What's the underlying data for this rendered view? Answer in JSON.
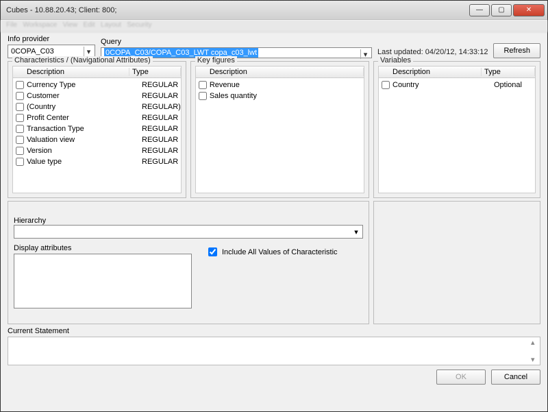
{
  "window": {
    "title": "Cubes - 10.88.20.43; Client: 800;"
  },
  "labels": {
    "info_provider": "Info provider",
    "query": "Query",
    "last_updated": "Last updated: 04/20/12, 14:33:12",
    "refresh": "Refresh",
    "characteristics": "Characteristics / (Navigational Attributes)",
    "key_figures": "Key figures",
    "variables": "Variables",
    "description": "Description",
    "type": "Type",
    "hierarchy": "Hierarchy",
    "display_attributes": "Display attributes",
    "include_all": "Include All Values of Characteristic",
    "current_statement": "Current Statement",
    "ok": "OK",
    "cancel": "Cancel"
  },
  "info_provider_value": "0COPA_C03",
  "query_value": "0COPA_C03/COPA_C03_LWT copa_c03_lwt",
  "characteristics": [
    {
      "desc": "Currency Type",
      "type": "REGULAR"
    },
    {
      "desc": "Customer",
      "type": "REGULAR"
    },
    {
      "desc": "(Country",
      "type": "REGULAR)"
    },
    {
      "desc": "Profit Center",
      "type": "REGULAR"
    },
    {
      "desc": "Transaction Type",
      "type": "REGULAR"
    },
    {
      "desc": "Valuation view",
      "type": "REGULAR"
    },
    {
      "desc": "Version",
      "type": "REGULAR"
    },
    {
      "desc": "Value type",
      "type": "REGULAR"
    }
  ],
  "key_figures": [
    {
      "desc": "Revenue"
    },
    {
      "desc": "Sales quantity"
    }
  ],
  "variables": [
    {
      "desc": "Country",
      "type": "Optional"
    }
  ],
  "include_all_checked": true
}
